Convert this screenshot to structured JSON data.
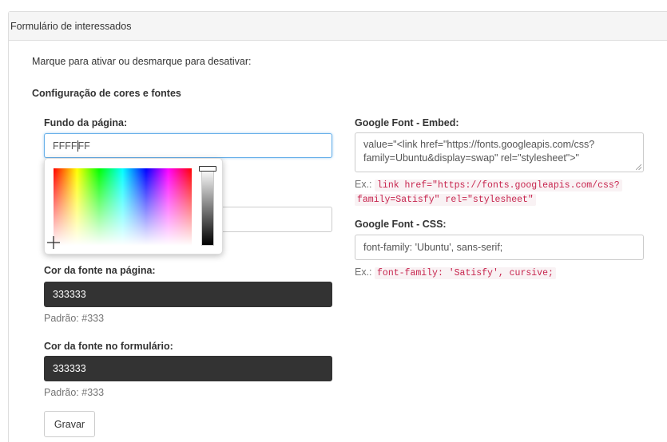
{
  "panel": {
    "title": "Formulário de interessados"
  },
  "intro": {
    "text": "Marque para ativar ou desmarque para desativar:"
  },
  "section": {
    "title": "Configuração de cores e fontes"
  },
  "page_bg": {
    "label": "Fundo da página:",
    "value_before_caret": "FFFF",
    "value_after_caret": "FF"
  },
  "picker": {
    "selected_color": "#FFFFFF"
  },
  "page_font": {
    "label": "Cor da fonte na página:",
    "value": "333333",
    "help": "Padrão: #333"
  },
  "form_font": {
    "label": "Cor da fonte no formulário:",
    "value": "333333",
    "help": "Padrão: #333"
  },
  "save_button": {
    "label": "Gravar"
  },
  "gf_embed": {
    "label": "Google Font - Embed:",
    "value_line1": "value=\"<link href=\"https://fonts.googleapis.com/css?",
    "value_line2": "family=Ubuntu&display=swap\" rel=\"stylesheet\">\"",
    "example_prefix": "Ex.:",
    "example_code_line1": "link href=\"https://fonts.googleapis.com/css?",
    "example_code_line2": "family=Satisfy\" rel=\"stylesheet\""
  },
  "gf_css": {
    "label": "Google Font - CSS:",
    "value": "font-family: 'Ubuntu', sans-serif;",
    "example_prefix": "Ex.:",
    "example_code": "font-family: 'Satisfy', cursive;"
  }
}
